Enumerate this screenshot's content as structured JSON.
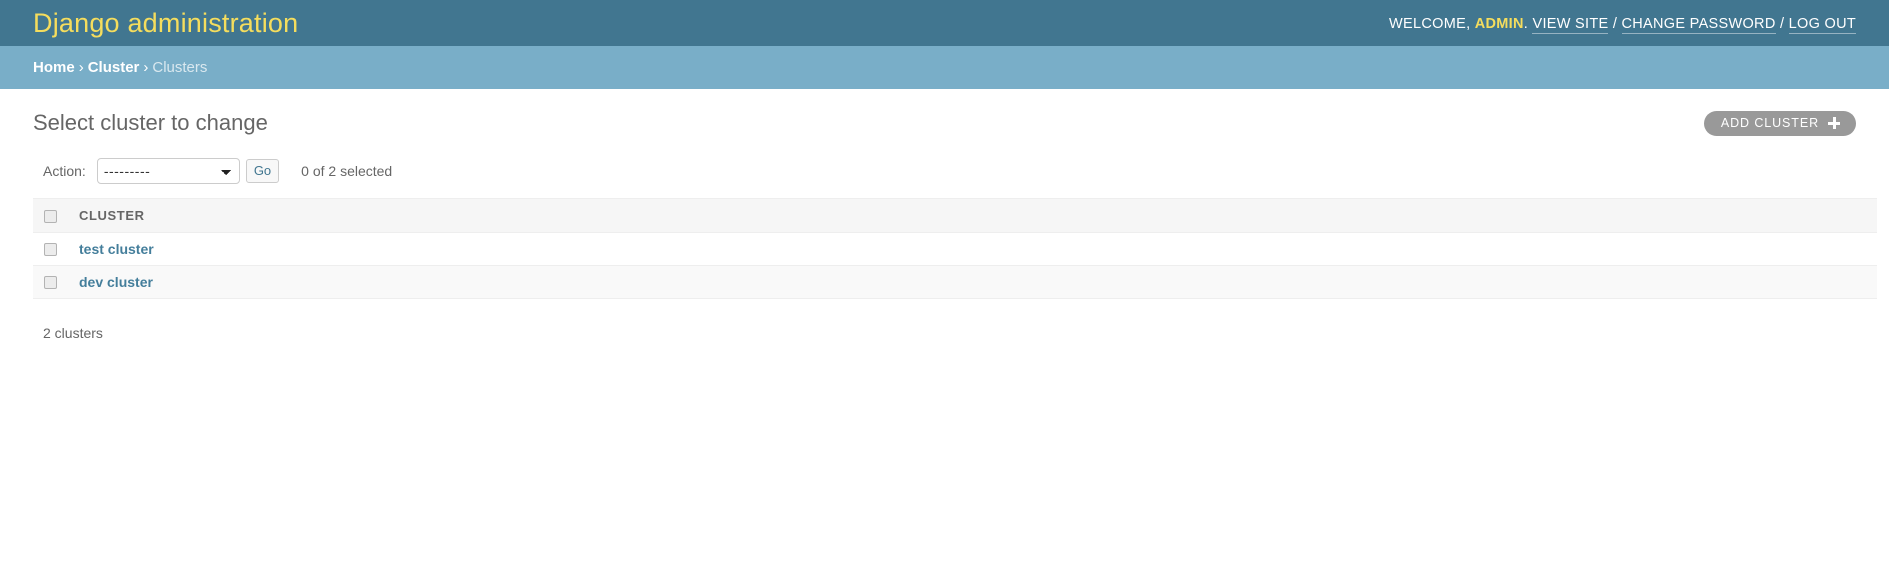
{
  "header": {
    "site_title": "Django administration",
    "user_tools": {
      "welcome_prefix": "Welcome,",
      "username": "ADMIN",
      "after_username": ".",
      "view_site": "View site",
      "separator": "/",
      "change_password": "Change password",
      "log_out": "Log out"
    }
  },
  "breadcrumbs": {
    "home": "Home",
    "sep": "›",
    "app": "Cluster",
    "current": "Clusters"
  },
  "content": {
    "page_title": "Select cluster to change",
    "object_tools": {
      "add_label": "Add cluster",
      "add_icon": "plus-icon"
    },
    "actions": {
      "label": "Action:",
      "selected_option": "---------",
      "options": [
        "---------"
      ],
      "go_label": "Go",
      "counter": "0 of 2 selected"
    },
    "result_list": {
      "columns": [
        "CLUSTER"
      ],
      "rows": [
        {
          "name": "test cluster",
          "selected": false
        },
        {
          "name": "dev cluster",
          "selected": false
        }
      ]
    },
    "paginator": {
      "count_text": "2 clusters"
    }
  },
  "colors": {
    "header_bg": "#417690",
    "header_link": "#f5dd5d",
    "breadcrumb_bg": "#79aec8",
    "link": "#447e9b",
    "button_bg": "#999999",
    "row_alt_bg": "#f9f9f9",
    "table_head_bg": "#f6f6f6"
  }
}
